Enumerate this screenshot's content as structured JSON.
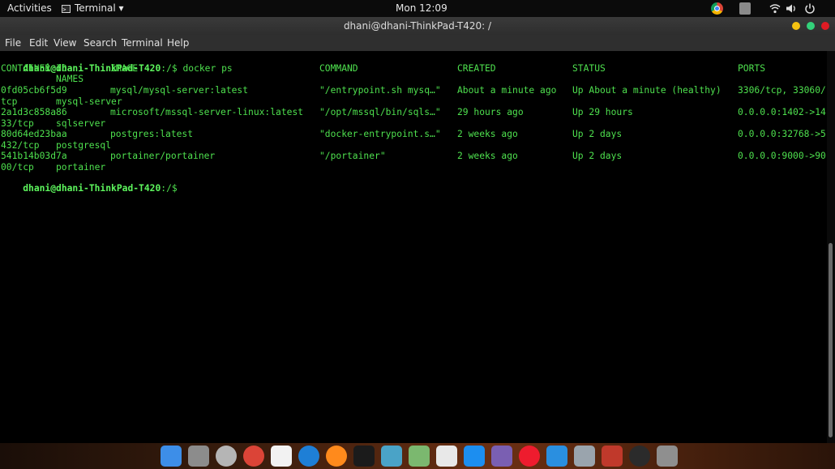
{
  "topbar": {
    "activities": "Activities",
    "app_menu": "Terminal ▾",
    "clock": "Mon 12:09"
  },
  "window": {
    "title": "dhani@dhani-ThinkPad-T420: /"
  },
  "menubar": {
    "items": [
      "File",
      "Edit",
      "View",
      "Search",
      "Terminal",
      "Help"
    ]
  },
  "terminal": {
    "prompt1": "dhani@dhani-ThinkPad-T420",
    "path1": ":/$ docker ps",
    "headers": {
      "container_id": "CONTAINER ID",
      "image": "IMAGE",
      "command": "COMMAND",
      "created": "CREATED",
      "status": "STATUS",
      "ports": "PORTS",
      "names": "NAMES"
    },
    "rows": [
      {
        "id": "0fd05cb6f5d9",
        "image": "mysql/mysql-server:latest",
        "command": "\"/entrypoint.sh mysq…\"",
        "created": "About a minute ago",
        "status": "Up About a minute (healthy)",
        "ports": "3306/tcp, 33060/",
        "ports_cont": "tcp",
        "name": "mysql-server"
      },
      {
        "id": "2a1d3c858a86",
        "image": "microsoft/mssql-server-linux:latest",
        "command": "\"/opt/mssql/bin/sqls…\"",
        "created": "29 hours ago",
        "status": "Up 29 hours",
        "ports": "0.0.0.0:1402->14",
        "ports_cont": "33/tcp",
        "name": "sqlserver"
      },
      {
        "id": "80d64ed23baa",
        "image": "postgres:latest",
        "command": "\"docker-entrypoint.s…\"",
        "created": "2 weeks ago",
        "status": "Up 2 days",
        "ports": "0.0.0.0:32768->5",
        "ports_cont": "432/tcp",
        "name": "postgresql"
      },
      {
        "id": "541b14b03d7a",
        "image": "portainer/portainer",
        "command": "\"/portainer\"",
        "created": "2 weeks ago",
        "status": "Up 2 days",
        "ports": "0.0.0.0:9000->90",
        "ports_cont": "00/tcp",
        "name": "portainer"
      }
    ],
    "prompt2": "dhani@dhani-ThinkPad-T420",
    "path2": ":/$ "
  },
  "dock": {
    "icons": [
      {
        "name": "finder-icon",
        "color": "#3d8ee8"
      },
      {
        "name": "system-preferences-icon",
        "color": "#8c8c8c"
      },
      {
        "name": "settings-gear-icon",
        "color": "#b5b5b5"
      },
      {
        "name": "chrome-icon",
        "color": "#db4437"
      },
      {
        "name": "calendar-icon",
        "color": "#f2f2f2"
      },
      {
        "name": "quicktime-icon",
        "color": "#1e7fd6"
      },
      {
        "name": "firefox-icon",
        "color": "#ff8a1c"
      },
      {
        "name": "terminal-icon",
        "color": "#1b1b1b"
      },
      {
        "name": "shotwell-icon",
        "color": "#4aa3c7"
      },
      {
        "name": "maps-icon",
        "color": "#7bb86f"
      },
      {
        "name": "photos-icon",
        "color": "#e8e8e8"
      },
      {
        "name": "app-store-icon",
        "color": "#1c8ef0"
      },
      {
        "name": "screen-recorder-icon",
        "color": "#7a5fb2"
      },
      {
        "name": "opera-icon",
        "color": "#ee1c2e"
      },
      {
        "name": "network-icon",
        "color": "#2a8fe0"
      },
      {
        "name": "disk-icon",
        "color": "#9aa4ad"
      },
      {
        "name": "photo-booth-icon",
        "color": "#c0392b"
      },
      {
        "name": "obs-icon",
        "color": "#2b2b2b"
      },
      {
        "name": "trash-icon",
        "color": "#8f8f8f"
      }
    ]
  }
}
